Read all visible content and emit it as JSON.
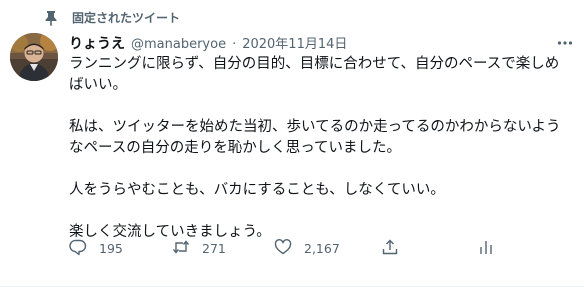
{
  "pinned": {
    "label": "固定されたツイート",
    "icon": "pin-icon"
  },
  "author": {
    "display_name": "りょうえ",
    "handle": "@manaberyoe",
    "separator": "·",
    "date": "2020年11月14日"
  },
  "tweet": {
    "paragraphs": [
      "ランニングに限らず、自分の目的、目標に合わせて、自分のペースで楽しめばいい。",
      "私は、ツイッターを始めた当初、歩いてるのか走ってるのかわからないようなペースの自分の走りを恥かしく思っていました。",
      "人をうらやむことも、バカにすることも、しなくていい。",
      "楽しく交流していきましょう。"
    ]
  },
  "actions": {
    "reply_count": "195",
    "retweet_count": "271",
    "like_count": "2,167"
  },
  "colors": {
    "secondary": "#536471",
    "text": "#0f1419"
  }
}
